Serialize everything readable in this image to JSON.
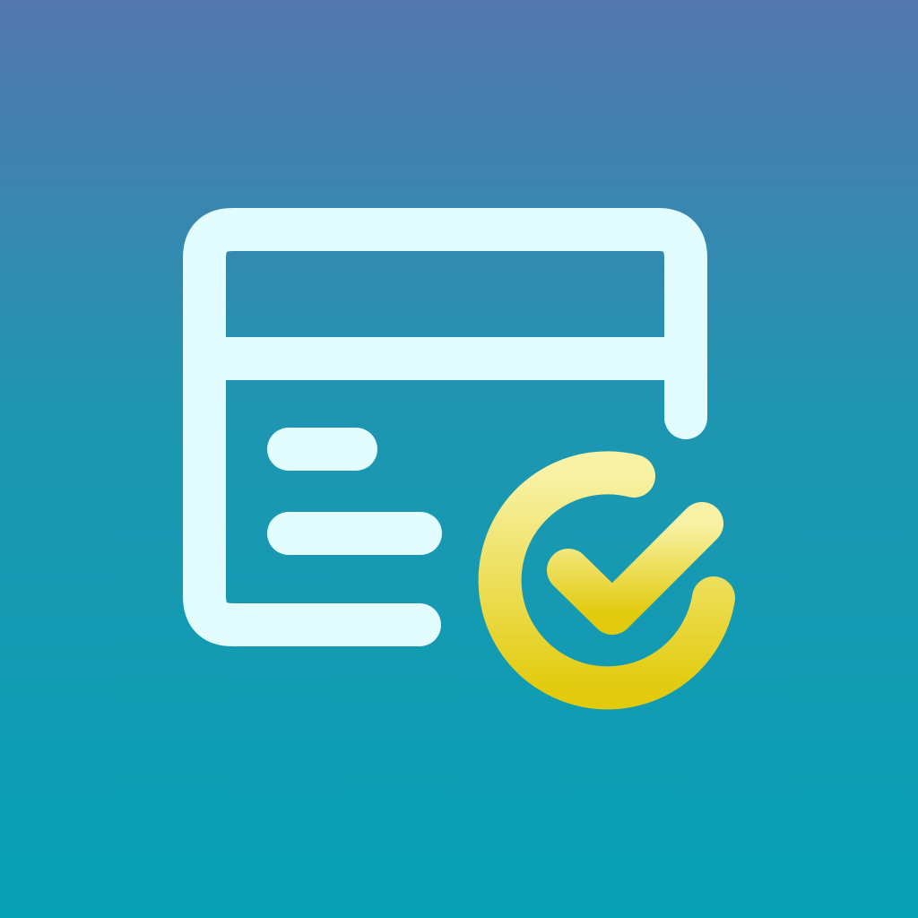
{
  "icon": {
    "name": "card-verified-icon",
    "description_glyphs": [
      "card-outline",
      "text-lines",
      "check-badge"
    ]
  },
  "colors": {
    "background_top": "#5477AE",
    "background_mid": "#1E96B1",
    "background_bottom": "#06A0B3",
    "card_stroke": "#E3FCFE",
    "badge_top": "#F8F2A6",
    "badge_bottom": "#E2CB0F"
  }
}
